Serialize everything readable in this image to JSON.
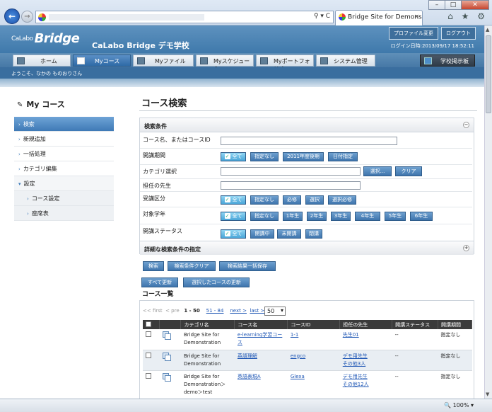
{
  "browser": {
    "tab_title": "Bridge Site for Demonst...",
    "tab_close": "×",
    "address_tools": "⚲ ▾ C",
    "back_glyph": "←",
    "forward_glyph": "→",
    "chrome_icons": "⌂ ★ ⚙",
    "zoom": "100%",
    "zoom_caret": "▾",
    "window_controls": {
      "minimize": "–",
      "maximize": "□",
      "close": "✕"
    }
  },
  "header": {
    "logo_prefix": "CaLabo",
    "logo_main": "Bridge",
    "app_name": "CaLabo Bridge デモ学校",
    "profile_button": "プロファイル変更",
    "logout_button": "ログアウト",
    "login_time": "ログイン日時:2013/09/17 18:52:11"
  },
  "menu": {
    "home": "ホーム",
    "my_course": "Myコース",
    "my_file": "Myファイル",
    "my_schedule": "Myスケジュール",
    "my_portfolio": "Myポートフォリオ",
    "system": "システム管理",
    "bulletin": "学校掲示板"
  },
  "welcome": "ようこそ、なかの ものおりさん",
  "sidebar": {
    "title": "My コース",
    "items": {
      "search": "検索",
      "add": "新規追加",
      "batch": "一括処理",
      "category": "カテゴリ編集",
      "settings": "設定",
      "course_settings": "コース設定",
      "seating": "座席表"
    }
  },
  "page": {
    "title": "コース検索"
  },
  "search": {
    "panel_title": "検索条件",
    "toggle_minus": "−",
    "toggle_plus": "+",
    "labels": {
      "course_name": "コース名、またはコースID",
      "period": "開講期間",
      "category": "カテゴリ選択",
      "teacher": "担任の先生",
      "attendance": "受講区分",
      "grade": "対象学年",
      "status": "開講ステータス"
    },
    "period_options": {
      "all": "全て",
      "none": "指定なし",
      "fy2011": "2011年度後期",
      "date": "日付指定"
    },
    "category_select": "選択...",
    "category_clear": "クリア",
    "attendance_options": {
      "all": "全て",
      "none": "指定なし",
      "required": "必修",
      "elective": "選択",
      "elective_required": "選択必修"
    },
    "grade_options": {
      "all": "全て",
      "none": "指定なし",
      "g1": "1年生",
      "g2": "2年生",
      "g3": "3年生",
      "g4": "4年生",
      "g5": "5年生",
      "g6": "6年生"
    },
    "status_options": {
      "all": "全て",
      "open": "開講中",
      "not_open": "未開講",
      "closed": "閉講"
    },
    "advanced_title": "詳細な検索条件の指定",
    "actions": {
      "search": "検索",
      "clear": "検索条件クリア",
      "save": "検索結果一括保存"
    }
  },
  "list": {
    "update_all": "すべて更新",
    "update_selected": "選択したコースの更新",
    "title": "コース一覧",
    "pager": {
      "first": "<< first",
      "prev": "< pre",
      "range": "1 - 50",
      "range_link": "51 - 84",
      "next": "next >",
      "last": "last >>",
      "per_page": "50",
      "caret": "▾"
    },
    "columns": {
      "category": "カテゴリ名",
      "course_name": "コース名",
      "course_id": "コースID",
      "teacher": "担任の先生",
      "status": "開講ステータス",
      "period": "開講期間"
    },
    "rows": [
      {
        "category": "Bridge Site for Demonstration",
        "course_name": "e-learning学習コース",
        "course_id": "1-1",
        "teacher": "先生01",
        "teacher2": "",
        "status": "--",
        "period": "指定なし"
      },
      {
        "category": "Bridge Site for Demonstration",
        "course_name": "英語理解",
        "course_id": "engco",
        "teacher": "デモ用先生",
        "teacher2": "その他3人",
        "status": "--",
        "period": "指定なし"
      },
      {
        "category": "Bridge Site for Demonstration＞demo＞test",
        "course_name": "英語表現A",
        "course_id": "Glexa",
        "teacher": "デモ用先生",
        "teacher2": "その他12人",
        "status": "--",
        "period": "指定なし"
      }
    ]
  }
}
